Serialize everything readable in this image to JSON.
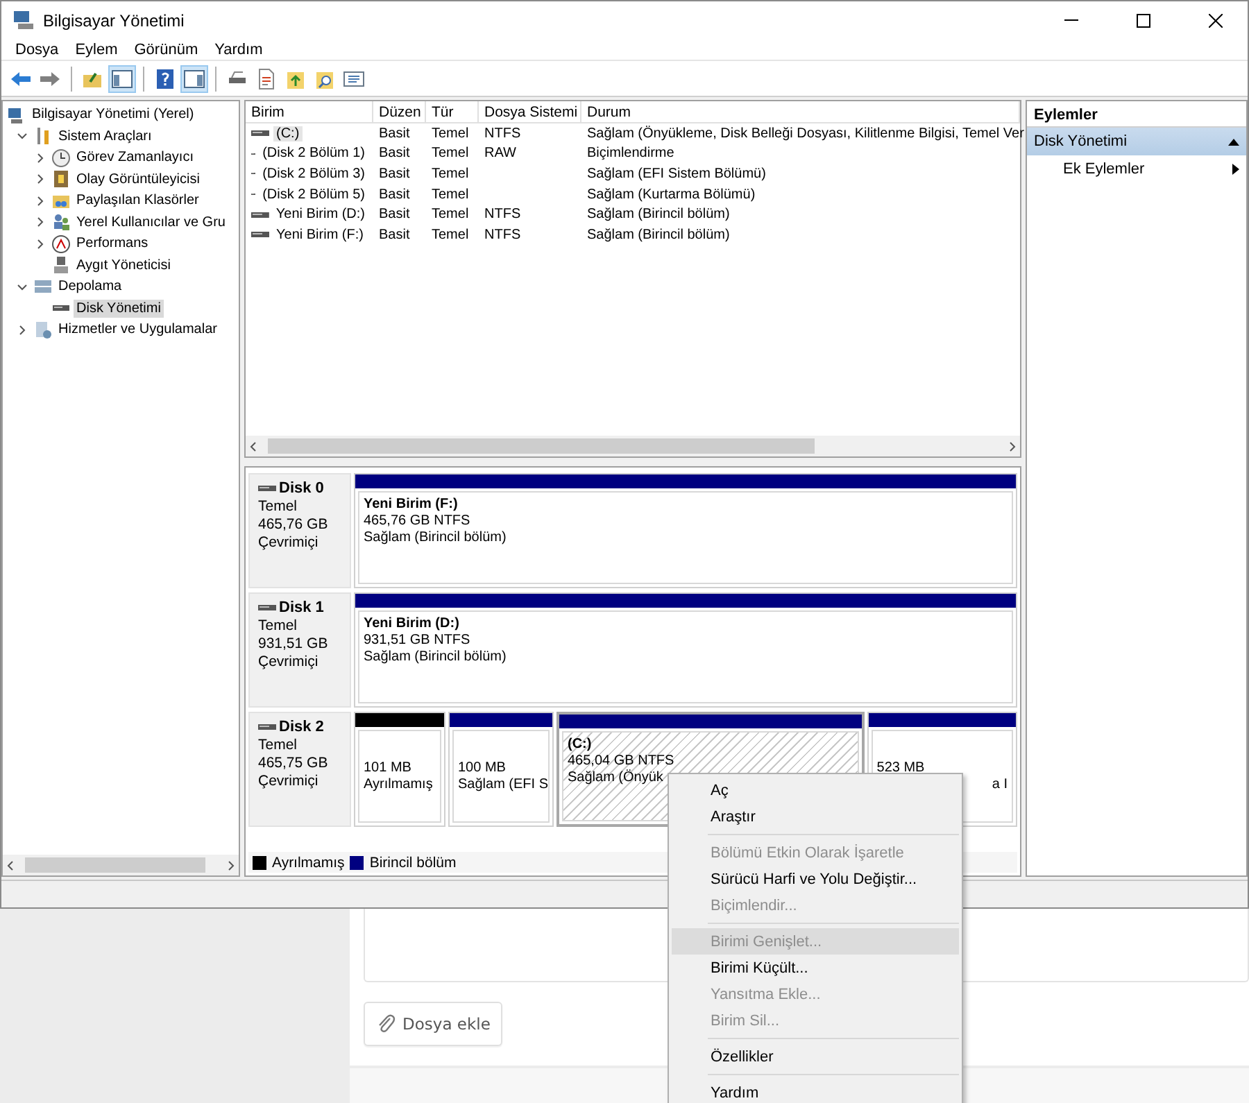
{
  "window": {
    "title": "Bilgisayar Yönetimi"
  },
  "menu": [
    "Dosya",
    "Eylem",
    "Görünüm",
    "Yardım"
  ],
  "toolbar": [
    {
      "kind": "button",
      "pressed": false
    },
    {
      "kind": "button",
      "pressed": false
    },
    {
      "kind": "separator"
    },
    {
      "kind": "button",
      "pressed": false
    },
    {
      "kind": "button",
      "pressed": true
    },
    {
      "kind": "separator"
    },
    {
      "kind": "button",
      "pressed": false
    },
    {
      "kind": "button",
      "pressed": true
    },
    {
      "kind": "separator"
    },
    {
      "kind": "button",
      "pressed": false
    },
    {
      "kind": "button",
      "pressed": false
    },
    {
      "kind": "button",
      "pressed": false
    },
    {
      "kind": "button",
      "pressed": false
    },
    {
      "kind": "button",
      "pressed": false
    }
  ],
  "tree": [
    {
      "label": "Bilgisayar Yönetimi (Yerel)",
      "selected": false,
      "children": [
        {
          "label": "Sistem Araçları",
          "expanded": true,
          "selected": false,
          "children": [
            {
              "label": "Görev Zamanlayıcı",
              "expanded": false,
              "selected": false
            },
            {
              "label": "Olay Görüntüleyicisi",
              "expanded": false,
              "selected": false
            },
            {
              "label": "Paylaşılan Klasörler",
              "expanded": false,
              "selected": false
            },
            {
              "label": "Yerel Kullanıcılar ve Gru",
              "expanded": false,
              "selected": false
            },
            {
              "label": "Performans",
              "expanded": false,
              "selected": false
            },
            {
              "label": "Aygıt Yöneticisi",
              "selected": false
            }
          ]
        },
        {
          "label": "Depolama",
          "expanded": true,
          "selected": false,
          "children": [
            {
              "label": "Disk Yönetimi",
              "selected": true
            }
          ]
        },
        {
          "label": "Hizmetler ve Uygulamalar",
          "expanded": false,
          "selected": false
        }
      ]
    }
  ],
  "volumes": {
    "columns": [
      "Birim",
      "Düzen",
      "Tür",
      "Dosya Sistemi",
      "Durum"
    ],
    "rows": [
      {
        "selected": true,
        "cells": [
          "(C:)",
          "Basit",
          "Temel",
          "NTFS",
          "Sağlam (Önyükleme, Disk Belleği Dosyası, Kilitlenme Bilgisi, Temel Ver"
        ]
      },
      {
        "selected": false,
        "cells": [
          "(Disk 2 Bölüm 1)",
          "Basit",
          "Temel",
          "RAW",
          "Biçimlendirme"
        ]
      },
      {
        "selected": false,
        "cells": [
          "(Disk 2 Bölüm 3)",
          "Basit",
          "Temel",
          "",
          "Sağlam (EFI Sistem Bölümü)"
        ]
      },
      {
        "selected": false,
        "cells": [
          "(Disk 2 Bölüm 5)",
          "Basit",
          "Temel",
          "",
          "Sağlam (Kurtarma Bölümü)"
        ]
      },
      {
        "selected": false,
        "cells": [
          "Yeni Birim (D:)",
          "Basit",
          "Temel",
          "NTFS",
          "Sağlam (Birincil bölüm)"
        ]
      },
      {
        "selected": false,
        "cells": [
          "Yeni Birim (F:)",
          "Basit",
          "Temel",
          "NTFS",
          "Sağlam (Birincil bölüm)"
        ]
      }
    ]
  },
  "disks": [
    {
      "name": "Disk 0",
      "type": "Temel",
      "size": "465,76 GB",
      "status": "Çevrimiçi",
      "partitions": [
        {
          "title": "Yeni Birim  (F:)",
          "size": "465,76 GB NTFS",
          "status": "Sağlam (Birincil bölüm)",
          "color": "#000080",
          "selected": false
        }
      ]
    },
    {
      "name": "Disk 1",
      "type": "Temel",
      "size": "931,51 GB",
      "status": "Çevrimiçi",
      "partitions": [
        {
          "title": "Yeni Birim  (D:)",
          "size": "931,51 GB NTFS",
          "status": "Sağlam (Birincil bölüm)",
          "color": "#000080",
          "selected": false
        }
      ]
    },
    {
      "name": "Disk 2",
      "type": "Temel",
      "size": "465,75 GB",
      "status": "Çevrimiçi",
      "partitions": [
        {
          "size": "101 MB",
          "status": "Ayrılmamış",
          "color": "#000000",
          "selected": false
        },
        {
          "size": "100 MB",
          "status": "Sağlam (EFI S",
          "color": "#000080",
          "selected": false
        },
        {
          "title": "(C:)",
          "size": "465,04 GB NTFS",
          "status": "Sağlam (Önyük",
          "color": "#000080",
          "selected": true
        },
        {
          "size": "523 MB",
          "status": "a I",
          "color": "#000080",
          "selected": false
        }
      ]
    }
  ],
  "legend": [
    {
      "label": "Ayrılmamış",
      "color": "#000000"
    },
    {
      "label": "Birincil bölüm",
      "color": "#000080"
    }
  ],
  "actions": {
    "title": "Eylemler",
    "sections": [
      {
        "label": "Disk Yönetimi",
        "expanded": true,
        "items": [
          "Ek Eylemler"
        ]
      }
    ]
  },
  "context_menu": [
    {
      "kind": "item",
      "label": "Aç",
      "disabled": false,
      "highlighted": false
    },
    {
      "kind": "item",
      "label": "Araştır",
      "disabled": false,
      "highlighted": false
    },
    {
      "kind": "separator"
    },
    {
      "kind": "item",
      "label": "Bölümü Etkin Olarak İşaretle",
      "disabled": true,
      "highlighted": false
    },
    {
      "kind": "item",
      "label": "Sürücü Harfi ve Yolu Değiştir...",
      "disabled": false,
      "highlighted": false
    },
    {
      "kind": "item",
      "label": "Biçimlendir...",
      "disabled": true,
      "highlighted": false
    },
    {
      "kind": "separator"
    },
    {
      "kind": "item",
      "label": "Birimi Genişlet...",
      "disabled": true,
      "highlighted": true
    },
    {
      "kind": "item",
      "label": "Birimi Küçült...",
      "disabled": false,
      "highlighted": false
    },
    {
      "kind": "item",
      "label": "Yansıtma Ekle...",
      "disabled": true,
      "highlighted": false
    },
    {
      "kind": "item",
      "label": "Birim Sil...",
      "disabled": true,
      "highlighted": false
    },
    {
      "kind": "separator"
    },
    {
      "kind": "item",
      "label": "Özellikler",
      "disabled": false,
      "highlighted": false
    },
    {
      "kind": "separator"
    },
    {
      "kind": "item",
      "label": "Yardım",
      "disabled": false,
      "highlighted": false
    }
  ],
  "page": {
    "attach_button": "Dosya ekle"
  }
}
